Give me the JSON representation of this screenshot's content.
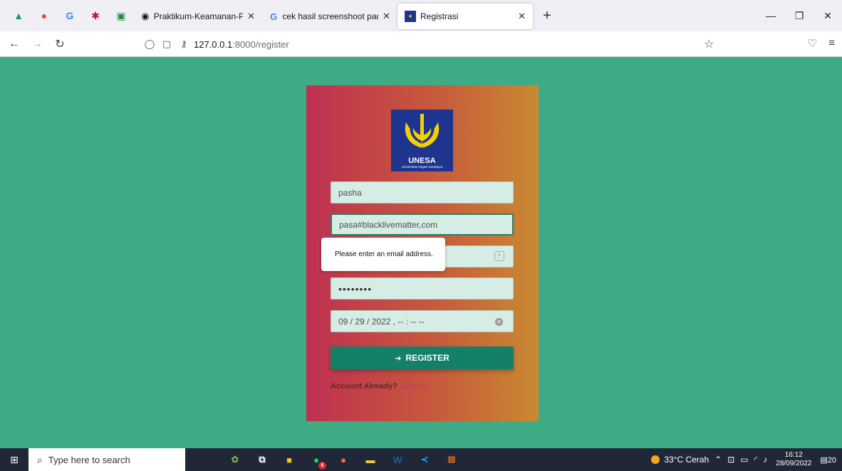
{
  "browser": {
    "tabs": [
      {
        "label": "Praktikum-Keamanan-Perangka",
        "icon": "github-icon"
      },
      {
        "label": "cek hasil screenshoot pada wind",
        "icon": "google-icon"
      },
      {
        "label": "Registrasi",
        "icon": "unesa-logo-icon",
        "active": true
      }
    ],
    "new_tab": "+",
    "url_host": "127.0.0.1",
    "url_path": ":8000/register"
  },
  "form": {
    "logo_name": "UNESA",
    "logo_sub": "Universitas Negeri Surabaya",
    "name_value": "pasha",
    "email_value": "pasa#blacklivematter,com",
    "password_value": "••••••••",
    "date_value": "09 / 29 / 2022 ,  -- : --   --",
    "register_label": "REGISTER",
    "account_text": "Account Already?",
    "signin_text": "Sign In",
    "tooltip": "Please enter an email address."
  },
  "taskbar": {
    "search_placeholder": "Type here to search",
    "badge_count": "6",
    "weather": "33°C  Cerah",
    "time": "16:12",
    "date": "28/09/2022",
    "notifications": "20"
  },
  "colors": {
    "page_bg": "#3eab84",
    "card_gradient_start": "#bf3052",
    "card_gradient_end": "#c88a32",
    "button": "#14806a"
  }
}
